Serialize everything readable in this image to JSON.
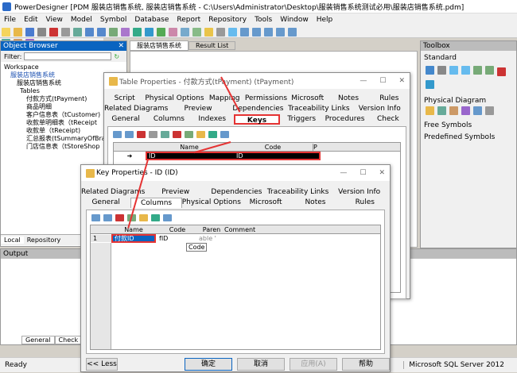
{
  "app": {
    "title": "PowerDesigner [PDM 服装店销售系统, 服装店销售系统 - C:\\Users\\Administrator\\Desktop\\服装销售系统测试必用\\服装店销售系统.pdm]"
  },
  "menu": [
    "File",
    "Edit",
    "View",
    "Model",
    "Symbol",
    "Database",
    "Report",
    "Repository",
    "Tools",
    "Window",
    "Help"
  ],
  "browser": {
    "title": "Object Browser",
    "filter": "Filter:",
    "items": [
      "Workspace",
      "服装店销售系统",
      "服装店销售系统",
      "Tables",
      "付款方式(tPayment)",
      "商品明细",
      "客户信息表（tCustomer)",
      "收款单明细表（tReceipt",
      "收款单（tReceipt)",
      "汇总报表(tSummaryOfBra",
      "门店信息表（tStoreShop"
    ],
    "tab_local": "Local",
    "tab_repo": "Repository"
  },
  "doc_tabs": [
    "服装店销售系统",
    "Result List"
  ],
  "toolbox": {
    "title": "Toolbox",
    "standard": "Standard",
    "physical": "Physical Diagram",
    "free": "Free Symbols",
    "predef": "Predefined Symbols"
  },
  "output": {
    "title": "Output",
    "tab_general": "General",
    "tab_check": "Check Mod"
  },
  "status": {
    "ready": "Ready",
    "db": "Microsoft SQL Server 2012"
  },
  "table_props": {
    "title": "Table Properties - 付款方式(tPayment) (tPayment)",
    "row1": [
      "Script",
      "Physical Options",
      "Mapping",
      "Permissions",
      "Microsoft",
      "Notes",
      "Rules"
    ],
    "row2": [
      "Related Diagrams",
      "Preview",
      "Dependencies",
      "Traceability Links",
      "Version Info"
    ],
    "row3": [
      "General",
      "Columns",
      "Indexes",
      "Keys",
      "Triggers",
      "Procedures",
      "Check"
    ],
    "col_name": "Name",
    "col_code": "Code",
    "row_name": "ID",
    "row_code": "ID"
  },
  "key_props": {
    "title": "Key Properties - ID (ID)",
    "row1": [
      "Related Diagrams",
      "Preview",
      "Dependencies",
      "Traceability Links",
      "Version Info"
    ],
    "row2": [
      "General",
      "Columns",
      "Physical Options",
      "Microsoft",
      "Notes",
      "Rules"
    ],
    "cols": [
      "Name",
      "Code",
      "Paren",
      "Comment"
    ],
    "row_num": "1",
    "row_name": "付款ID",
    "row_code": "fID",
    "row_parent": "able '",
    "tooltip": "Code",
    "less": "<< Less",
    "ok": "确定",
    "cancel": "取消",
    "apply": "应用(A)",
    "help": "帮助"
  },
  "colors": {
    "accent": "#0a64c0",
    "highlight": "#e53333"
  }
}
